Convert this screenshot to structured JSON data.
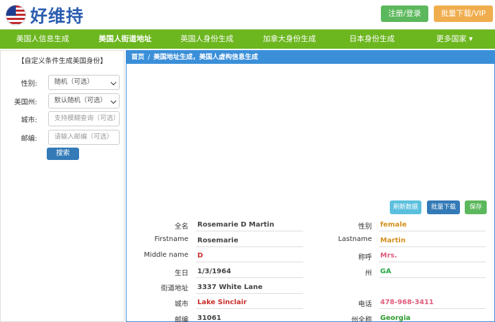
{
  "header": {
    "logo_text": "好维持",
    "login_label": "注册/登录",
    "vip_label": "批量下载/VIP"
  },
  "nav": {
    "items": [
      {
        "label": "美国人信息生成"
      },
      {
        "label": "美国人街道地址"
      },
      {
        "label": "英国人身份生成"
      },
      {
        "label": "加拿大身份生成"
      },
      {
        "label": "日本身份生成"
      },
      {
        "label": "更多国家 ▾"
      }
    ]
  },
  "sidebar": {
    "title": "【自定义条件生成美国身份】",
    "gender_label": "性别:",
    "gender_value": "随机（可选）",
    "state_label": "美国州:",
    "state_value": "默认随机（可选）",
    "city_label": "城市:",
    "city_placeholder": "支持模糊查询（可选）",
    "zip_label": "邮编:",
    "zip_placeholder": "请输入邮编（可选）",
    "search_label": "搜索"
  },
  "panel": {
    "breadcrumb_home": "首页",
    "breadcrumb_sep": "/",
    "breadcrumb_current": "美国地址生成，美国人虚构信息生成",
    "refresh_label": "刷新数据",
    "batch_label": "批量下载",
    "save_label": "保存"
  },
  "profile": {
    "fullname_label": "全名",
    "fullname": "Rosemarie D Martin",
    "gender_label": "性别",
    "gender": "female",
    "firstname_label": "Firstname",
    "firstname": "Rosemarie",
    "lastname_label": "Lastname",
    "lastname": "Martin",
    "middlename_label": "Middle name",
    "middlename": "D",
    "title_label": "称呼",
    "title": "Mrs.",
    "birthday_label": "生日",
    "birthday": "1/3/1964",
    "state_label": "州",
    "state": "GA",
    "street_label": "街道地址",
    "street": "3337 White Lane",
    "city_label": "城市",
    "city": "Lake Sinclair",
    "phone_label": "电话",
    "phone": "478-968-3411",
    "zip_label": "邮编",
    "zip": "31061",
    "state_full_label": "州全称",
    "state_full": "Georgia"
  },
  "colors": {
    "nav_green": "#6cb61f",
    "panel_blue": "#3b8fd9",
    "login_green": "#5cb85c",
    "vip_orange": "#f0ad4e"
  }
}
